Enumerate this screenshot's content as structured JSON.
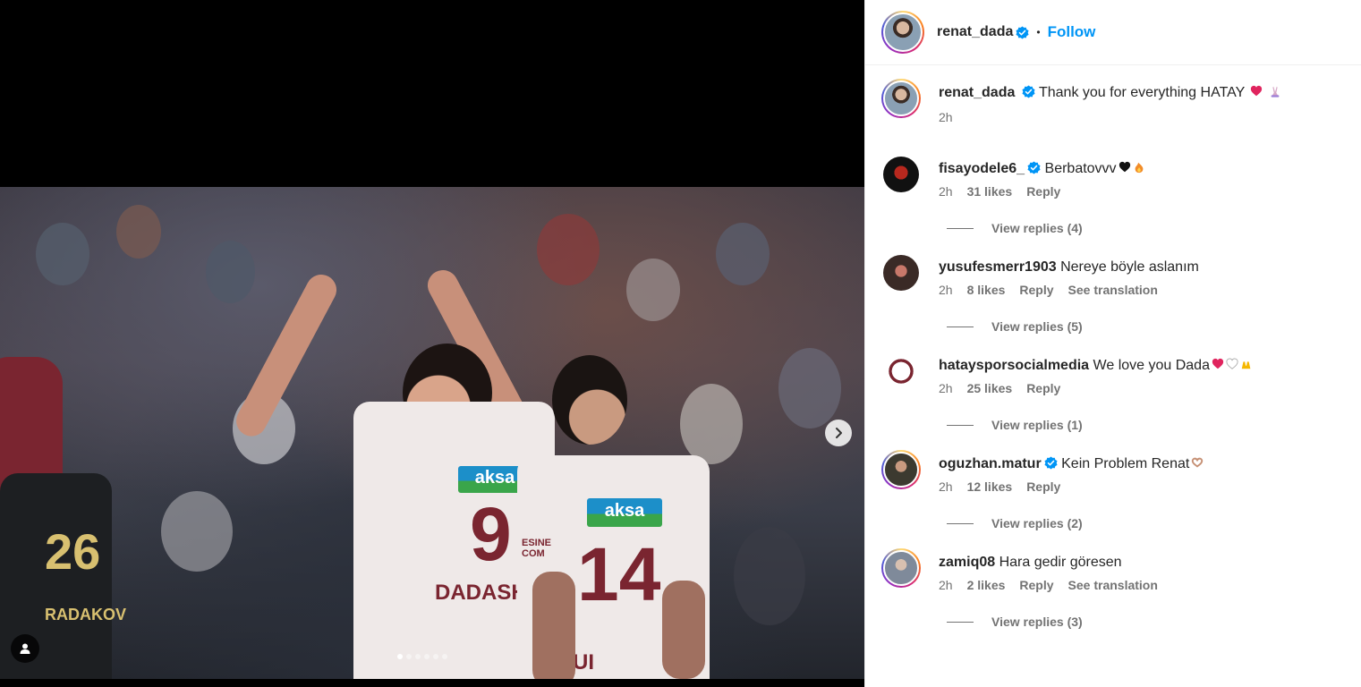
{
  "post": {
    "author": "renat_dada",
    "follow_label": "Follow",
    "dot_separator": "•",
    "carousel": {
      "slide_count": 6,
      "active_slide": 1
    },
    "photo": {
      "player_left": {
        "sponsor": "aksa",
        "number": "9",
        "name": "DADASHO"
      },
      "player_right": {
        "sponsor": "aksa",
        "number": "14",
        "name": "UI PEDO"
      },
      "player_edge": {
        "number": "26",
        "name": "RADAKOV"
      },
      "sleeve_text": "ESINE COM"
    }
  },
  "caption": {
    "username": "renat_dada",
    "text": "Thank you for everything HATAY",
    "time": "2h"
  },
  "comments": [
    {
      "username": "fisayodele6_",
      "verified": true,
      "text": "Berbatovvv",
      "time": "2h",
      "likes": "31 likes",
      "reply": "Reply",
      "translation": "",
      "view_replies": "View replies (4)"
    },
    {
      "username": "yusufesmerr1903",
      "verified": false,
      "text": "Nereye böyle aslanım",
      "time": "2h",
      "likes": "8 likes",
      "reply": "Reply",
      "translation": "See translation",
      "view_replies": "View replies (5)"
    },
    {
      "username": "hataysporsocialmedia",
      "verified": false,
      "text": "We love you Dada",
      "time": "2h",
      "likes": "25 likes",
      "reply": "Reply",
      "translation": "",
      "view_replies": "View replies (1)"
    },
    {
      "username": "oguzhan.matur",
      "verified": true,
      "text": "Kein Problem Renat",
      "time": "2h",
      "likes": "12 likes",
      "reply": "Reply",
      "translation": "",
      "view_replies": "View replies (2)"
    },
    {
      "username": "zamiq08",
      "verified": false,
      "text": "Hara gedir göresen",
      "time": "2h",
      "likes": "2 likes",
      "reply": "Reply",
      "translation": "See translation",
      "view_replies": "View replies (3)"
    }
  ],
  "colors": {
    "accent": "#0095f6",
    "verified": "#0095f6",
    "text": "#262626",
    "secondary": "#737373",
    "jersey_maroon": "#7a2530"
  }
}
